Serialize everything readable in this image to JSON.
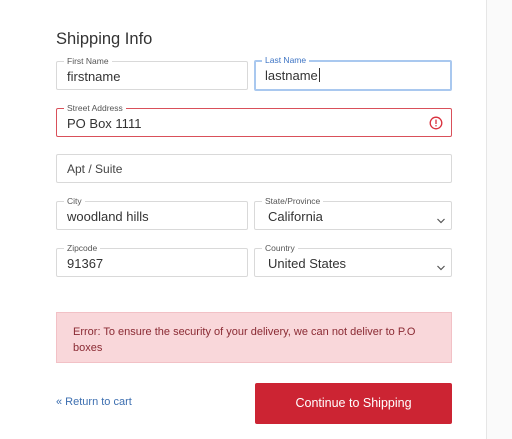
{
  "form": {
    "title": "Shipping Info",
    "first_name": {
      "label": "First Name",
      "value": "firstname"
    },
    "last_name": {
      "label": "Last Name",
      "value": "lastname"
    },
    "street_address": {
      "label": "Street Address",
      "value": "PO Box 1111"
    },
    "apt_suite": {
      "placeholder": "Apt / Suite"
    },
    "city": {
      "label": "City",
      "value": "woodland hills"
    },
    "state": {
      "label": "State/Province",
      "value": "California"
    },
    "zipcode": {
      "label": "Zipcode",
      "value": "91367"
    },
    "country": {
      "label": "Country",
      "value": "United States"
    }
  },
  "error": {
    "message": "Error: To ensure the security of your delivery, we can not deliver to P.O boxes"
  },
  "actions": {
    "return_link": "« Return to cart",
    "continue_label": "Continue to Shipping"
  },
  "colors": {
    "brand_red": "#cc2433",
    "focus_blue": "#a9c8ef",
    "error_red": "#d9505a",
    "error_bg": "#f9d7da",
    "link_blue": "#3d6fb0"
  },
  "icons": {
    "street_address_error": "alert-circle-icon",
    "dropdown": "chevron-down-icon"
  }
}
